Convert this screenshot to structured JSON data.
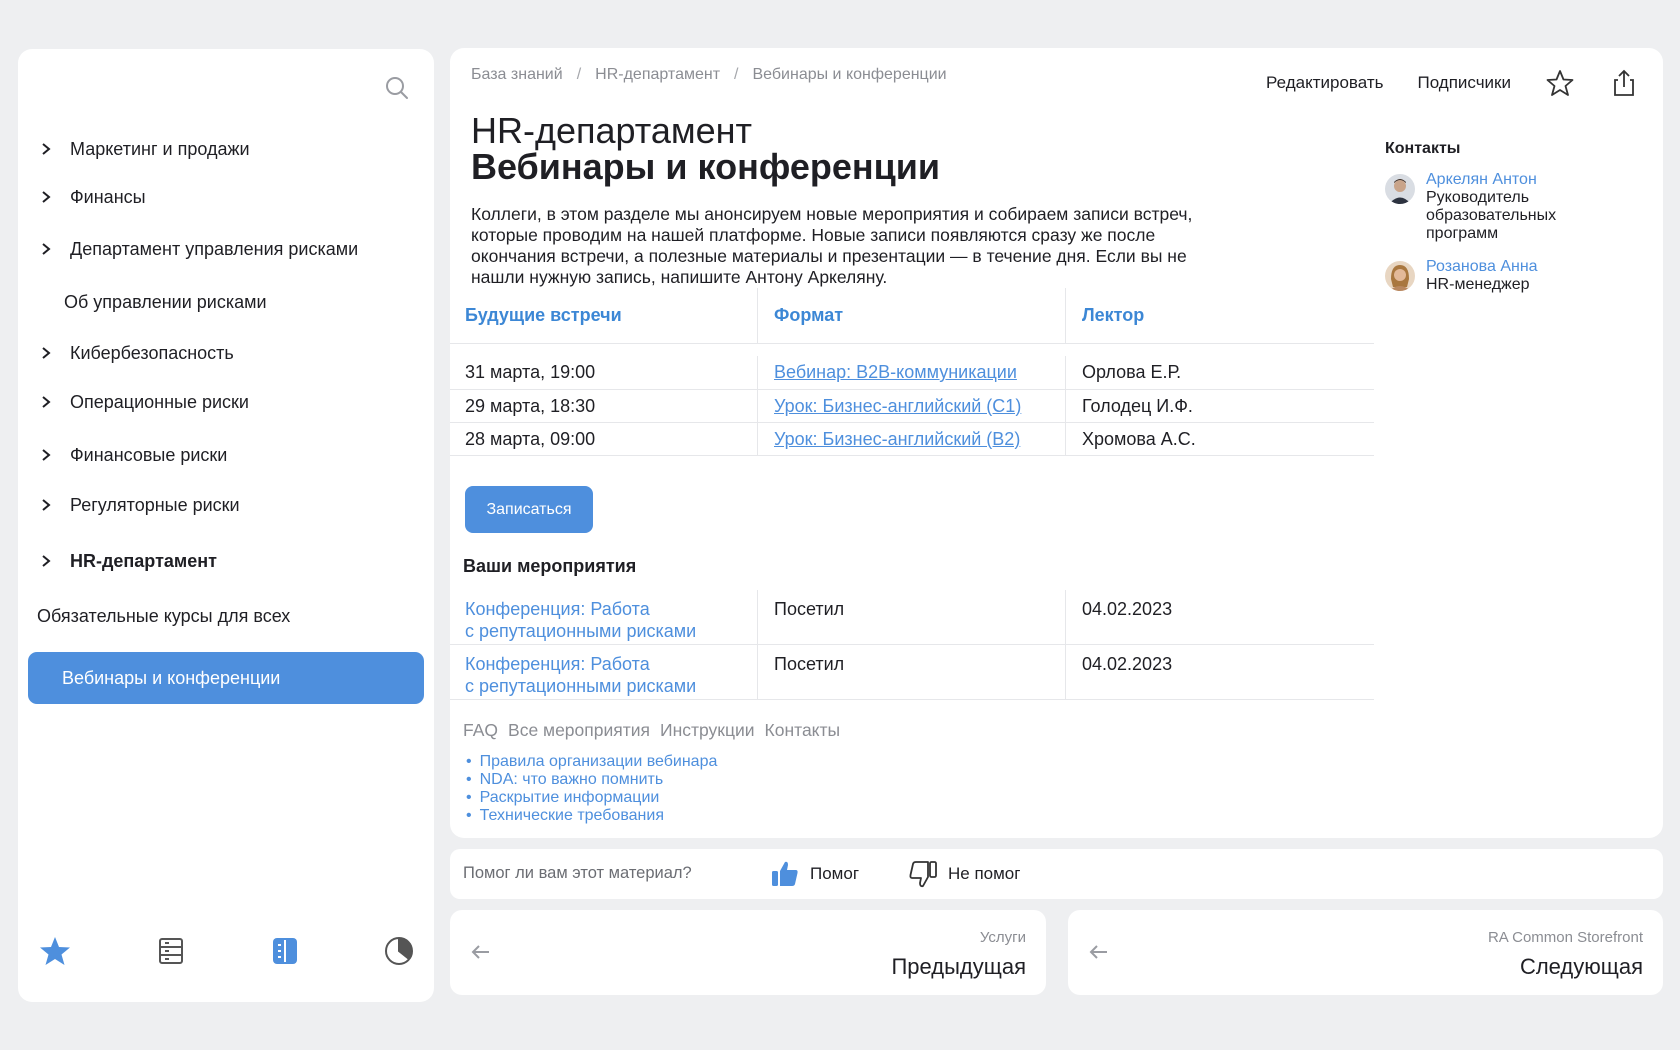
{
  "sidebar": {
    "items": [
      {
        "label": "Маркетинг и продажи",
        "has_chevron": true
      },
      {
        "label": "Финансы",
        "has_chevron": true
      },
      {
        "label": "Департамент управления рисками",
        "has_chevron": true
      },
      {
        "label": "Об управлении рисками",
        "has_chevron": false
      },
      {
        "label": "Кибербезопасность",
        "has_chevron": true
      },
      {
        "label": "Операционные риски",
        "has_chevron": true
      },
      {
        "label": "Финансовые риски",
        "has_chevron": true
      },
      {
        "label": "Регуляторные риски",
        "has_chevron": true
      },
      {
        "label": "HR-департамент",
        "has_chevron": true,
        "bold": true
      },
      {
        "label": "Обязательные курсы для всех",
        "has_chevron": false
      }
    ],
    "active_item": "Вебинары и конференции",
    "bottom_icons": [
      "star-icon",
      "catalog-icon",
      "book-icon",
      "chart-icon"
    ]
  },
  "breadcrumb": [
    "База знаний",
    "HR-департамент",
    "Вебинары и конференции"
  ],
  "actions": {
    "edit": "Редактировать",
    "subscribers": "Подписчики"
  },
  "page": {
    "title_line1": "HR-департамент",
    "title_line2": "Вебинары и конференции",
    "intro": "Коллеги, в этом разделе мы анонсируем новые мероприятия и собираем записи встреч, которые проводим на нашей платформе. Новые записи появляются сразу же после окончания встречи, а полезные материалы и презентации — в течение дня. Если вы не нашли нужную запись, напишите Антону Аркеляну."
  },
  "upcoming": {
    "headers": [
      "Будущие встречи",
      "Формат",
      "Лектор"
    ],
    "rows": [
      {
        "date": "31 марта, 19:00",
        "format": "Вебинар: B2B-коммуникации",
        "lecturer": "Орлова Е.Р."
      },
      {
        "date": "29 марта, 18:30",
        "format": "Урок: Бизнес-английский (C1)",
        "lecturer": "Голодец И.Ф."
      },
      {
        "date": "28 марта, 09:00",
        "format": "Урок: Бизнес-английский (B2)",
        "lecturer": "Хромова А.С."
      }
    ],
    "signup_label": "Записаться"
  },
  "my_events": {
    "title": "Ваши мероприятия",
    "rows": [
      {
        "name_line1": "Конференция: Работа",
        "name_line2": "с репутационными рисками",
        "status": "Посетил",
        "date": "04.02.2023"
      },
      {
        "name_line1": "Конференция: Работа",
        "name_line2": "с репутационными рисками",
        "status": "Посетил",
        "date": "04.02.2023"
      }
    ]
  },
  "footer_tabs": [
    "FAQ",
    "Все мероприятия",
    "Инструкции",
    "Контакты"
  ],
  "resources": [
    "Правила организации вебинара",
    "NDA: что важно помнить",
    "Раскрытие информации",
    "Технические требования"
  ],
  "contacts": {
    "title": "Контакты",
    "people": [
      {
        "name": "Аркелян Антон",
        "role_lines": [
          "Руководитель",
          "образовательных",
          "программ"
        ]
      },
      {
        "name": "Розанова Анна",
        "role_lines": [
          "HR-менеджер"
        ]
      }
    ]
  },
  "feedback": {
    "question": "Помог ли вам этот материал?",
    "yes": "Помог",
    "no": "Не помог"
  },
  "pager": {
    "prev_sub": "Услуги",
    "prev_label": "Предыдущая",
    "next_sub": "RA Common Storefront",
    "next_label": "Следующая"
  },
  "colors": {
    "accent": "#4e8fdd",
    "background": "#eeeff1"
  }
}
